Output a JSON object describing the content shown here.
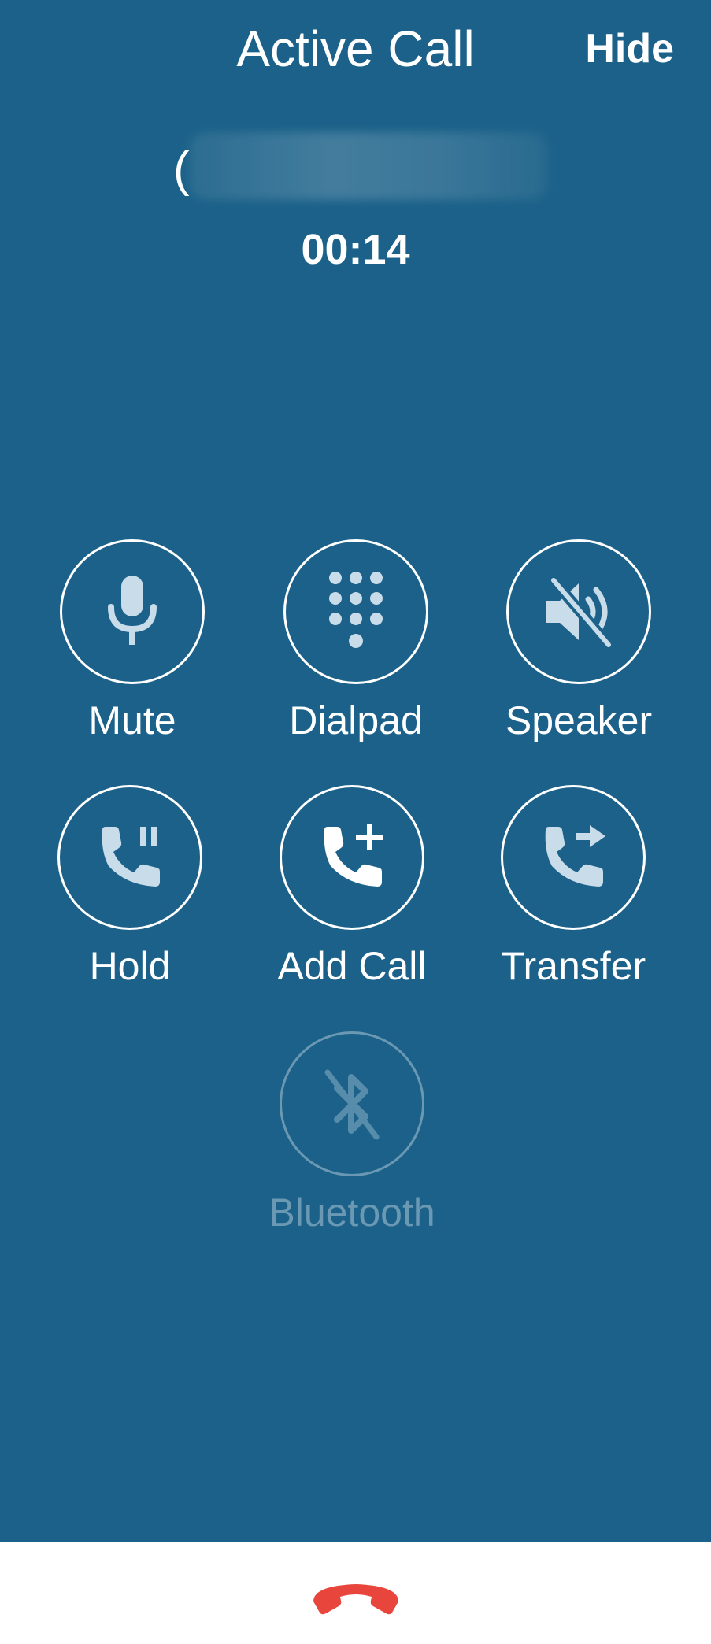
{
  "header": {
    "title": "Active Call",
    "hide_label": "Hide"
  },
  "call": {
    "number_prefix": "(",
    "duration": "00:14"
  },
  "controls": [
    {
      "label": "Mute",
      "icon": "microphone-icon",
      "enabled": true
    },
    {
      "label": "Dialpad",
      "icon": "dialpad-icon",
      "enabled": true
    },
    {
      "label": "Speaker",
      "icon": "speaker-off-icon",
      "enabled": true
    },
    {
      "label": "Hold",
      "icon": "phone-pause-icon",
      "enabled": true
    },
    {
      "label": "Add Call",
      "icon": "phone-plus-icon",
      "enabled": true
    },
    {
      "label": "Transfer",
      "icon": "phone-forward-icon",
      "enabled": true
    },
    {
      "label": "Bluetooth",
      "icon": "bluetooth-off-icon",
      "enabled": false
    }
  ],
  "end_call": {
    "icon": "end-call-icon"
  },
  "colors": {
    "background": "#1b6189",
    "foreground": "#ffffff",
    "icon_fill": "#c9dcea",
    "end_call_red": "#e8453c",
    "bottom_bar": "#ffffff"
  }
}
